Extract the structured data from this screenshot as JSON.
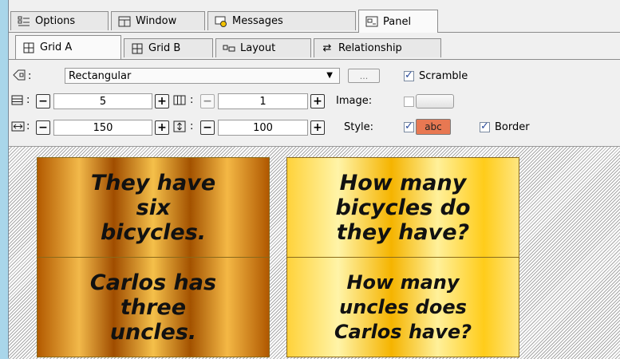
{
  "top_tabs": [
    {
      "label": "Options",
      "icon": "options-icon"
    },
    {
      "label": "Window",
      "icon": "window-icon"
    },
    {
      "label": "Messages",
      "icon": "messages-icon"
    },
    {
      "label": "Panel",
      "icon": "panel-icon",
      "active": true
    }
  ],
  "sub_tabs": [
    {
      "label": "Grid A",
      "icon": "grid-icon",
      "active": true
    },
    {
      "label": "Grid B",
      "icon": "grid-icon"
    },
    {
      "label": "Layout",
      "icon": "layout-icon"
    },
    {
      "label": "Relationship",
      "icon": "relationship-icon"
    }
  ],
  "shape": {
    "value": "Rectangular",
    "browse_label": "...",
    "scramble_label": "Scramble",
    "scramble_checked": true
  },
  "rows": {
    "label": ":",
    "value": "5"
  },
  "columns": {
    "label": ":",
    "value": "1"
  },
  "image": {
    "label": "Image:",
    "checked": false
  },
  "width": {
    "label": ":",
    "value": "150"
  },
  "height": {
    "label": ":",
    "value": "100"
  },
  "style": {
    "label": "Style:",
    "checked": true,
    "swatch_text": "abc",
    "swatch_color": "#e87852"
  },
  "border": {
    "label": "Border",
    "checked": true
  },
  "cards": [
    {
      "text": "They have\nsix\nbicycles.",
      "theme": "bronze"
    },
    {
      "text": "How many\nbicycles do\nthey have?",
      "theme": "gold"
    },
    {
      "text": "Carlos has\nthree\nuncles.",
      "theme": "bronze"
    },
    {
      "text": "How many\nuncles does\nCarlos have?",
      "theme": "gold"
    }
  ]
}
